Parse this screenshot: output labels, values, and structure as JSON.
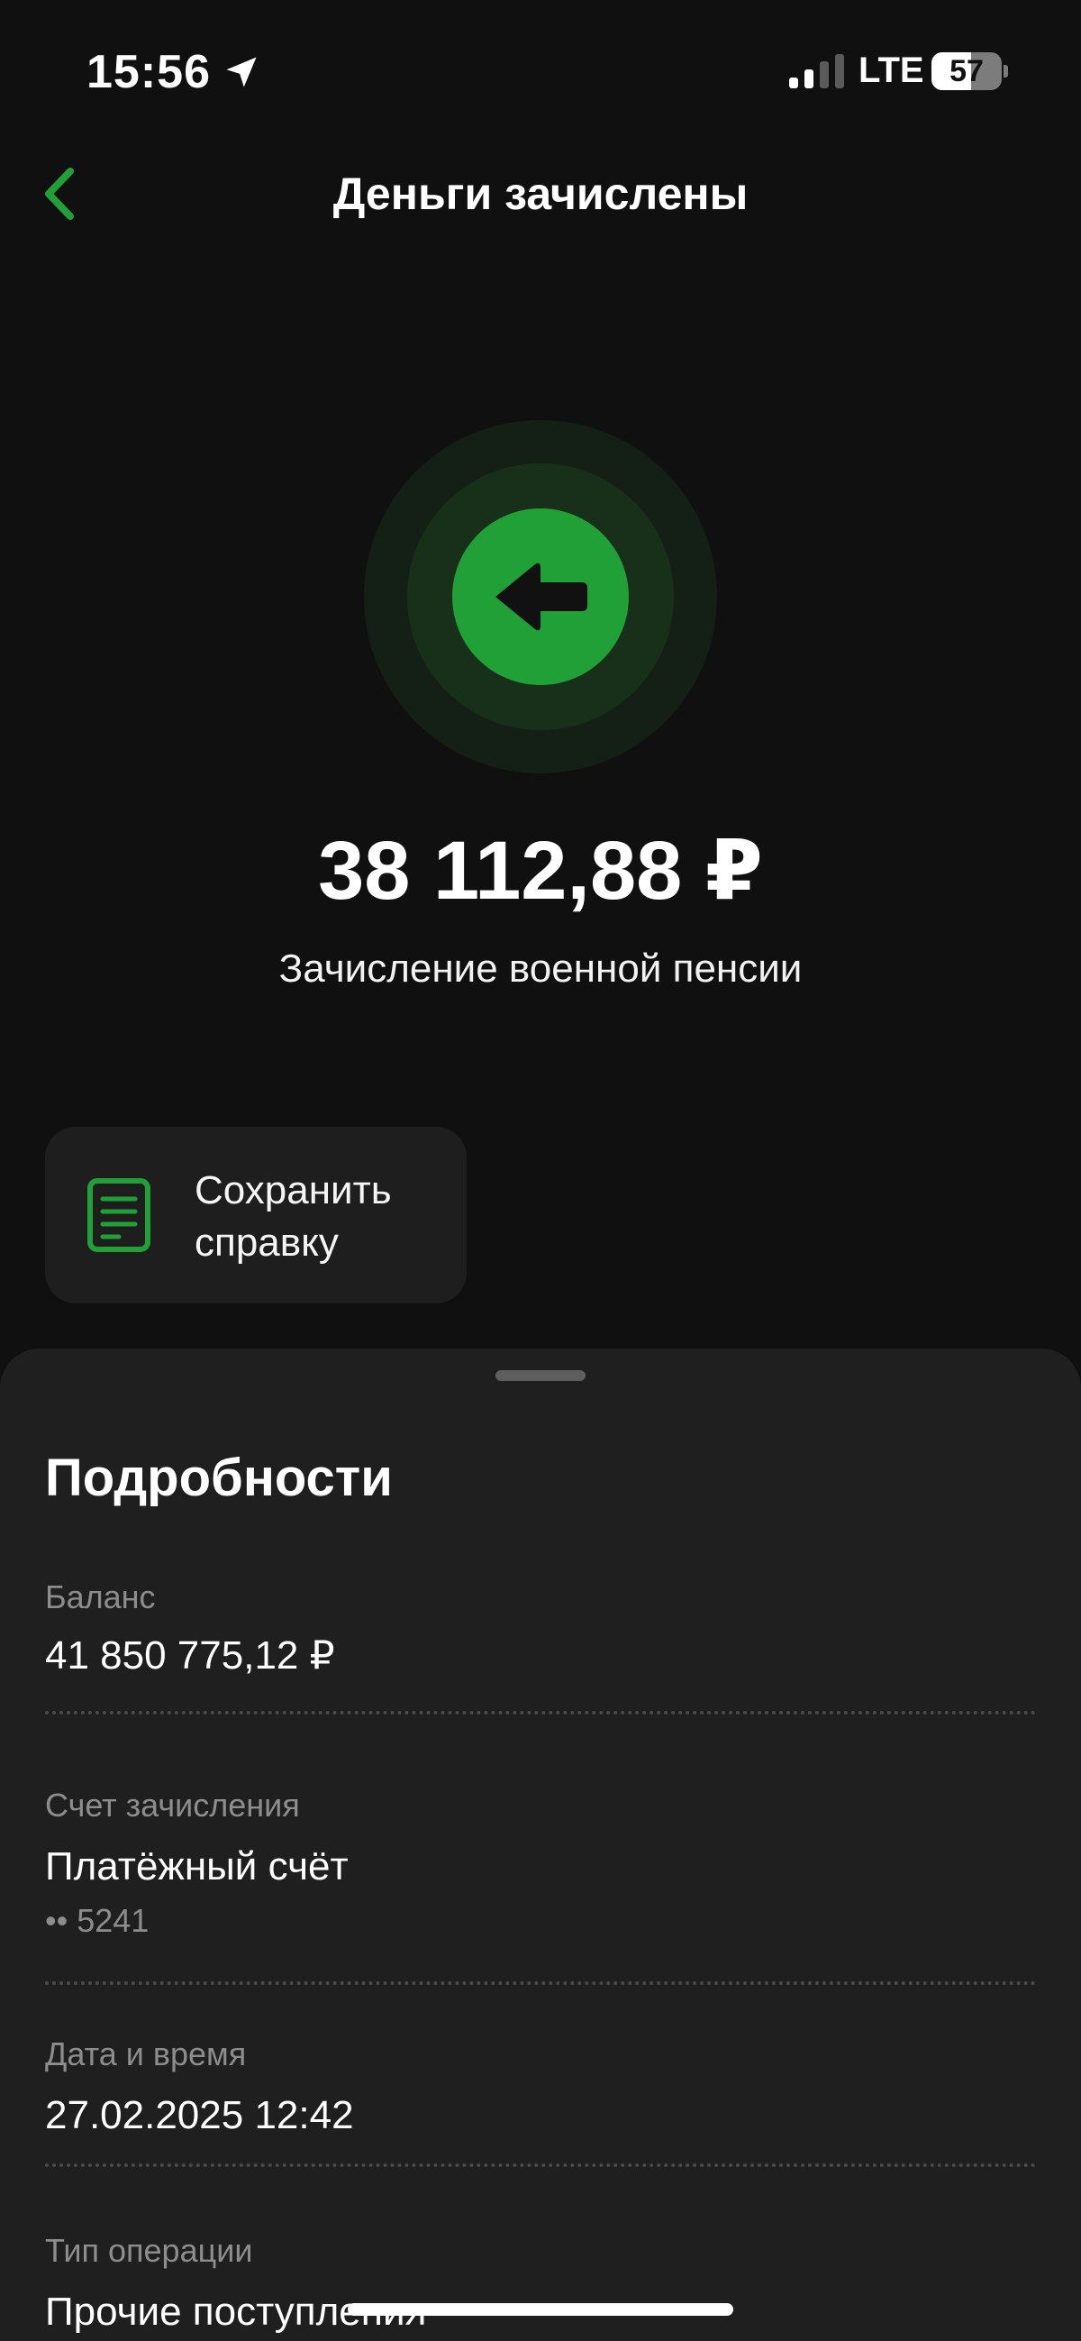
{
  "status_bar": {
    "time": "15:56",
    "network": "LTE",
    "battery_level": "57",
    "battery_fraction": 0.57,
    "icons": [
      "location-arrow-icon",
      "signal-bars-icon",
      "battery-icon"
    ]
  },
  "nav": {
    "title": "Деньги зачислены",
    "back_icon": "chevron-left-icon"
  },
  "colors": {
    "accent": "#21a038",
    "background": "#101010",
    "sheet": "#1f1f1f",
    "secondary_text": "#8d8d8d"
  },
  "hero": {
    "icon": "arrow-left-icon",
    "amount": "38 112,88 ₽",
    "operation": "Зачисление военной пенсии"
  },
  "actions": {
    "save_certificate_line1": "Сохранить",
    "save_certificate_line2": "справку",
    "save_icon": "document-icon"
  },
  "details": {
    "title": "Подробности",
    "balance_label": "Баланс",
    "balance_value": "41 850 775,12 ₽",
    "account_label": "Счет зачисления",
    "account_value": "Платёжный счёт",
    "account_number": "•• 5241",
    "datetime_label": "Дата и время",
    "datetime_value": "27.02.2025 12:42",
    "type_label": "Тип операции",
    "type_value": "Прочие поступления"
  }
}
